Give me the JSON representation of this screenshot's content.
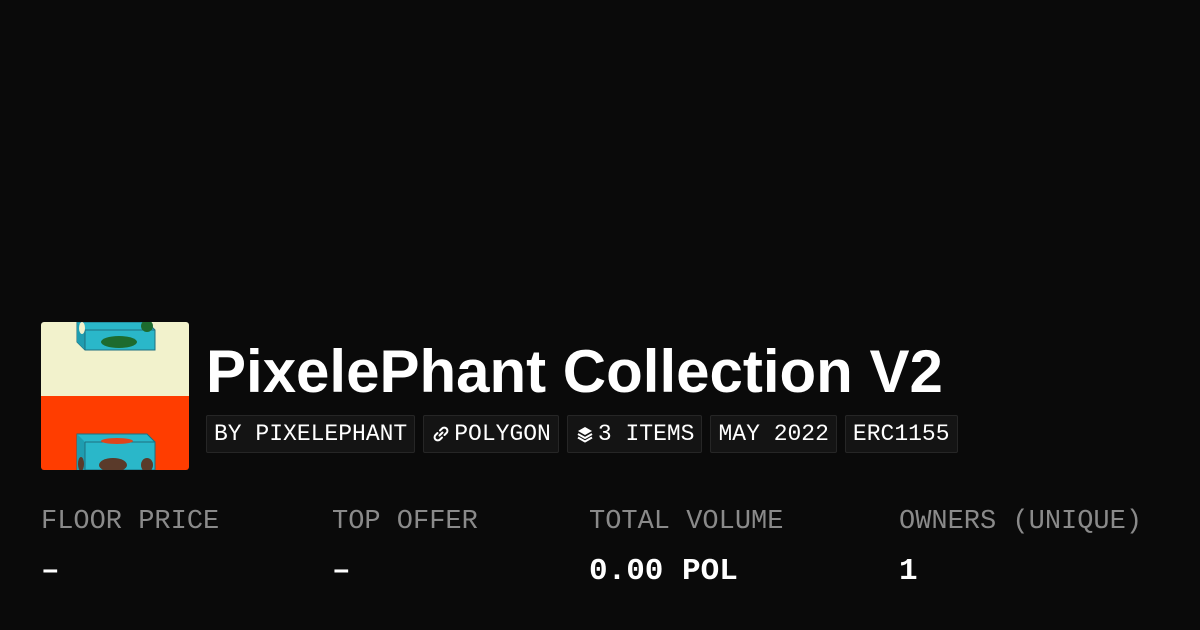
{
  "collection": {
    "title": "PixelePhant Collection V2",
    "thumbnail_icon": "pixel-elephant-box-artwork",
    "colors": {
      "background": "#0a0a0a",
      "thumb_top": "#f2f2cc",
      "thumb_bottom": "#ff3d00",
      "thumb_box": "#2ab7c9",
      "muted_text": "#8a8a8a"
    }
  },
  "tags": {
    "creator": "BY PIXELEPHANT",
    "chain": "POLYGON",
    "chain_icon": "chain-link-icon",
    "items": "3 ITEMS",
    "items_icon": "layers-icon",
    "date": "MAY 2022",
    "standard": "ERC1155"
  },
  "stats": {
    "floor_price": {
      "label": "FLOOR PRICE",
      "value": "–"
    },
    "top_offer": {
      "label": "TOP OFFER",
      "value": "–"
    },
    "total_volume": {
      "label": "TOTAL VOLUME",
      "value": "0.00 POL"
    },
    "owners": {
      "label": "OWNERS (UNIQUE)",
      "value": "1"
    }
  }
}
